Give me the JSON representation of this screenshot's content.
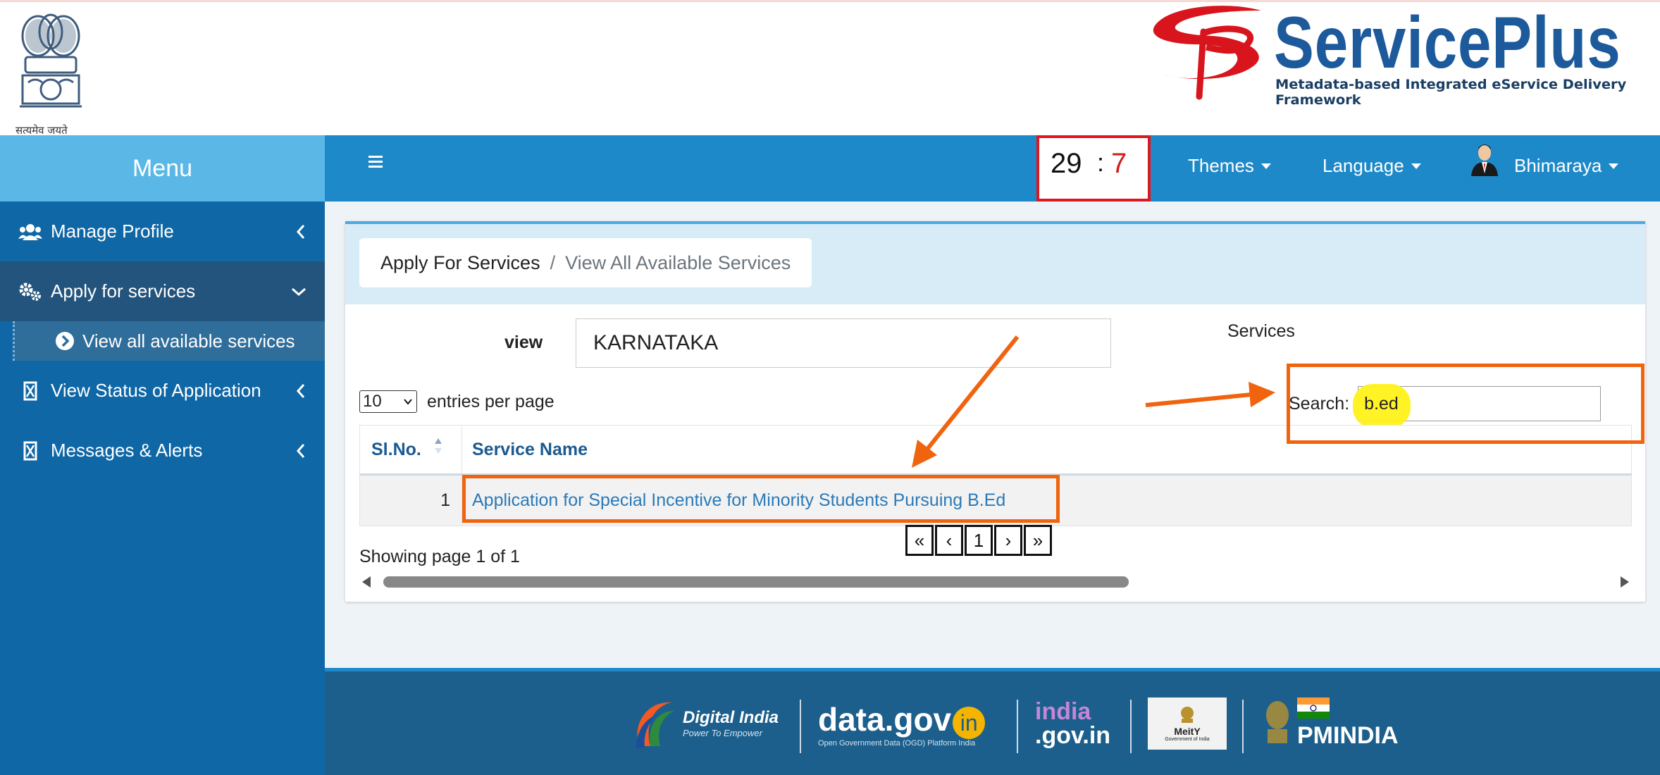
{
  "header": {
    "emblem_caption": "सत्यमेव जयते",
    "brand_title": "ServicePlus",
    "brand_subtitle": "Metadata-based Integrated eService Delivery Framework"
  },
  "sidebar": {
    "title": "Menu",
    "items": [
      {
        "label": "Manage Profile",
        "icon": "users-icon",
        "expanded": false
      },
      {
        "label": "Apply for services",
        "icon": "gears-icon",
        "expanded": true
      },
      {
        "label": "View Status of Application",
        "icon": "hourglass-icon",
        "expanded": false
      },
      {
        "label": "Messages & Alerts",
        "icon": "hourglass-icon",
        "expanded": false
      }
    ],
    "sub_items": [
      {
        "label": "View all available services",
        "icon": "circle-chevron-right-icon"
      }
    ]
  },
  "navbar": {
    "timer_minutes": "29",
    "timer_separator": ":",
    "timer_seconds": "7",
    "themes_label": "Themes",
    "language_label": "Language",
    "user_label": "Bhimaraya"
  },
  "breadcrumb": {
    "root": "Apply For Services",
    "separator": "/",
    "current": "View All Available Services"
  },
  "filters": {
    "view_label": "view",
    "view_value": "KARNATAKA",
    "services_label": "Services",
    "entries_value": "10",
    "entries_label": "entries per page",
    "search_label": "Search:",
    "search_value": "b.ed"
  },
  "table": {
    "columns": [
      "Sl.No.",
      "Service Name"
    ],
    "rows": [
      {
        "sl": "1",
        "name": "Application for Special Incentive for Minority Students Pursuing B.Ed"
      }
    ]
  },
  "pagination": {
    "first": "«",
    "prev": "‹",
    "page": "1",
    "next": "›",
    "last": "»",
    "showing": "Showing page 1 of 1"
  },
  "footer": {
    "digital_india": "Digital India",
    "digital_india_sub": "Power To Empower",
    "datagov": "data.gov",
    "datagov_in": "in",
    "datagov_sub": "Open Government Data (OGD) Platform India",
    "indiagov_top": "india",
    "indiagov_bottom": ".gov.in",
    "meity": "MeitY",
    "meity_sub": "Government of India",
    "pmindia": "PMINDIA"
  },
  "colors": {
    "sidebar": "#0f67a6",
    "sidebar_head": "#5bb8e6",
    "navbar": "#1e89c8",
    "annotation": "#f0640f",
    "timer_border": "#e0161f",
    "link": "#2a7ab8"
  }
}
